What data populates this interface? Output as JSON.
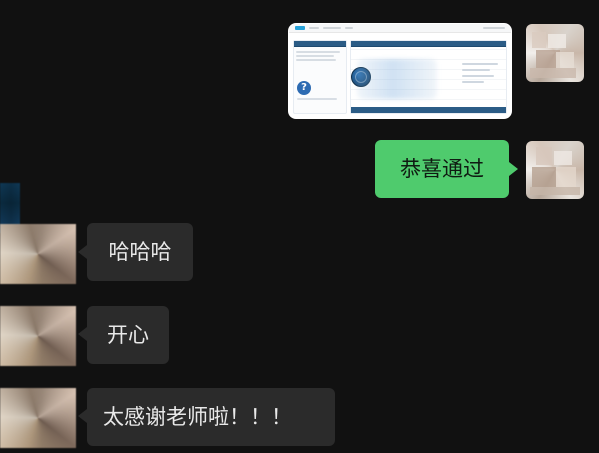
{
  "chat": {
    "messages": [
      {
        "sender": "me",
        "kind": "image"
      },
      {
        "sender": "me",
        "kind": "text",
        "text": "恭喜通过"
      },
      {
        "sender": "other",
        "kind": "text",
        "text": "哈哈哈"
      },
      {
        "sender": "other",
        "kind": "text",
        "text": "开心"
      },
      {
        "sender": "other",
        "kind": "text",
        "text": "太感谢老师啦！！！"
      }
    ]
  },
  "colors": {
    "background": "#111111",
    "outgoing_bubble": "#4fcb6d",
    "incoming_bubble": "#2b2b2b",
    "incoming_text": "#e9e9e9",
    "outgoing_text": "#0f1b12"
  }
}
